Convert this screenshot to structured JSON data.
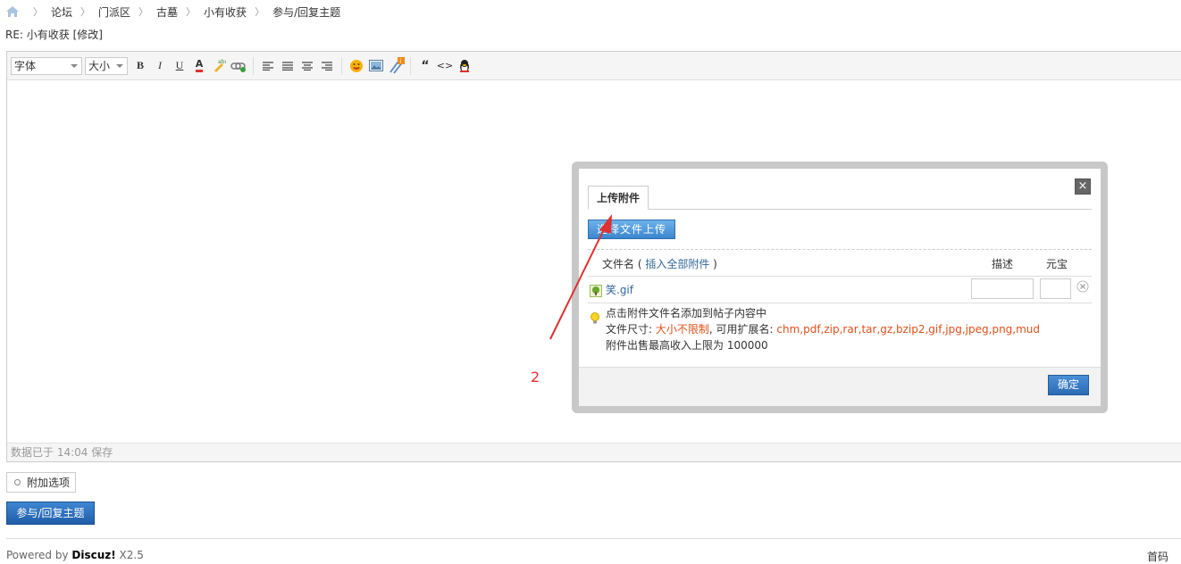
{
  "breadcrumb": {
    "items": [
      "论坛",
      "门派区",
      "古墓",
      "小有收获",
      "参与/回复主题"
    ]
  },
  "thread": {
    "title": "RE: 小有收获 [修改]"
  },
  "toolbar": {
    "font_select": "字体",
    "size_select": "大小",
    "bold": "B",
    "italic": "I",
    "underline": "U",
    "color": "A",
    "quote": "“",
    "code": "<>"
  },
  "editor": {
    "status": "数据已于 14:04 保存"
  },
  "dialog": {
    "tab_label": "上传附件",
    "close": "×",
    "upload_button": "选择文件上传",
    "col_filename_prefix": "文件名 (",
    "col_insert_all": "插入全部附件",
    "col_filename_suffix": ")",
    "col_description": "描述",
    "col_price": "元宝",
    "file_name": "笑.gif",
    "tip_line1": "点击附件文件名添加到帖子内容中",
    "tip_size_label": "文件尺寸: ",
    "tip_size_value": "大小不限制",
    "tip_ext_label": ", 可用扩展名: ",
    "tip_ext_value": "chm,pdf,zip,rar,tar,gz,bzip2,gif,jpg,jpeg,png,mud",
    "tip_line3": "附件出售最高收入上限为 100000",
    "ok_button": "确定"
  },
  "annotation": {
    "label": "2"
  },
  "actions": {
    "extra_options": "附加选项",
    "submit": "参与/回复主题"
  },
  "footer": {
    "powered_prefix": "Powered by ",
    "powered_brand": "Discuz!",
    "powered_version": " X2.5",
    "right_text": "首码"
  },
  "colors": {
    "accent_blue": "#2b6cb5",
    "link_blue": "#336699",
    "warn_red": "#e0501b",
    "annotation_red": "#e03030"
  }
}
